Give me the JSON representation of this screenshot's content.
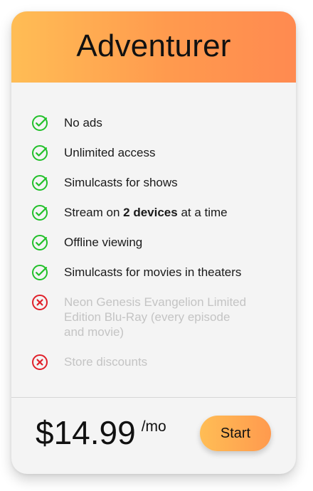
{
  "plan": {
    "title": "Adventurer",
    "accent_colors": [
      "#ffbd55",
      "#ff8a50"
    ]
  },
  "features": [
    {
      "included": true,
      "icon": "check-circle-icon",
      "text": "No ads"
    },
    {
      "included": true,
      "icon": "check-circle-icon",
      "text": "Unlimited access"
    },
    {
      "included": true,
      "icon": "check-circle-icon",
      "text": "Simulcasts for shows"
    },
    {
      "included": true,
      "icon": "check-circle-icon",
      "text_before": "Stream on ",
      "text_bold": "2 devices",
      "text_after": " at a time"
    },
    {
      "included": true,
      "icon": "check-circle-icon",
      "text": "Offline viewing"
    },
    {
      "included": true,
      "icon": "check-circle-icon",
      "text": "Simulcasts for movies in theaters"
    },
    {
      "included": false,
      "icon": "x-circle-icon",
      "text": "Neon Genesis Evangelion Limited Edition Blu-Ray (every episode and movie)"
    },
    {
      "included": false,
      "icon": "x-circle-icon",
      "text": "Store discounts"
    }
  ],
  "pricing": {
    "amount": "$14.99",
    "period": "/mo"
  },
  "cta": {
    "label": "Start"
  },
  "colors": {
    "included": "#22c02a",
    "excluded": "#e0202a",
    "excluded_text": "#c4c4c4"
  }
}
